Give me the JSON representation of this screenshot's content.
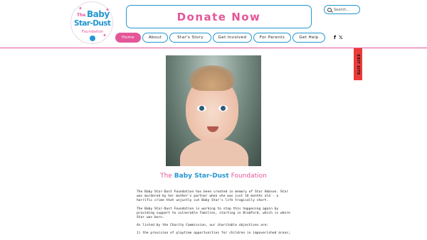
{
  "logo": {
    "the": "The",
    "baby": "Baby",
    "star_dust": "Star-Dust",
    "foundation": "Foundation"
  },
  "donate": {
    "label": "Donate Now"
  },
  "search": {
    "placeholder": "Search..."
  },
  "nav": {
    "items": [
      {
        "label": "Home",
        "active": true
      },
      {
        "label": "About"
      },
      {
        "label": "Star's Story"
      },
      {
        "label": "Get Involved"
      },
      {
        "label": "For Parents"
      },
      {
        "label": "Get Help"
      }
    ]
  },
  "social": {
    "facebook": "f",
    "twitter": "𝕏"
  },
  "exit_site": {
    "label": "EXIT SITE"
  },
  "heading": {
    "the": "The",
    "brand": "Baby Star-Dust",
    "rest": "Foundation"
  },
  "body": {
    "p1": "The Baby Star-Dust Foundation has been created in memory of Star Hobson.  Star was murdered by her mother's partner when she was just 16 months old - a horrific crime that unjustly cut Baby Star's life tragically short.",
    "p2": "The Baby Star-Dust Foundation is working to stop this happening again by providing support to vulnerable families, starting in Bradford, which is where Star was born.",
    "p3": "As listed by the Charity Commission, our charitable objectives are:",
    "p4": "1) the provision of playtime opportunities for children in impoverished areas;"
  },
  "colors": {
    "pink": "#e4569a",
    "blue": "#2596d1",
    "exit_red": "#ea3b38"
  }
}
